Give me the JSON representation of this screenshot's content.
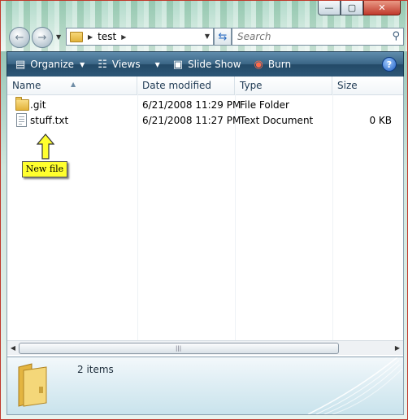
{
  "window": {
    "buttons": {
      "minimize": "—",
      "maximize": "▢",
      "close": "✕"
    }
  },
  "nav": {
    "back_icon": "←",
    "forward_icon": "→",
    "breadcrumb": [
      "test"
    ],
    "search_placeholder": "Search"
  },
  "toolbar": {
    "items": [
      {
        "label": "Organize",
        "icon": "organize-icon"
      },
      {
        "label": "Views",
        "icon": "views-icon"
      },
      {
        "label": "Slide Show",
        "icon": "slideshow-icon"
      },
      {
        "label": "Burn",
        "icon": "burn-icon"
      }
    ],
    "help": "?"
  },
  "columns": [
    "Name",
    "Date modified",
    "Type",
    "Size"
  ],
  "files": [
    {
      "name": ".git",
      "date": "6/21/2008 11:29 PM",
      "type": "File Folder",
      "size": "",
      "icon": "folder-icon"
    },
    {
      "name": "stuff.txt",
      "date": "6/21/2008 11:27 PM",
      "type": "Text Document",
      "size": "0 KB",
      "icon": "text-file-icon"
    }
  ],
  "annotation": {
    "label": "New file",
    "color": "#ffff2e"
  },
  "status": {
    "item_count": "2 items"
  }
}
